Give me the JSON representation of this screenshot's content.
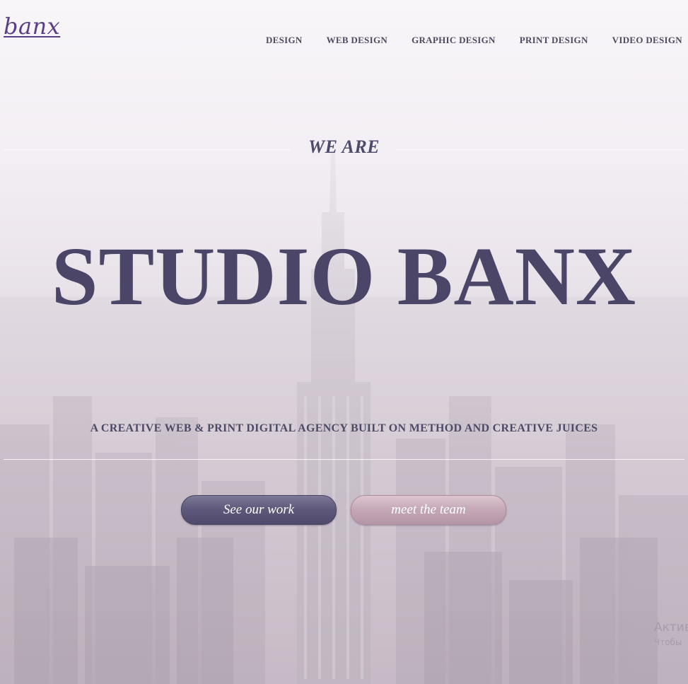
{
  "header": {
    "logo": "banx",
    "nav": [
      {
        "label": "DESIGN"
      },
      {
        "label": "WEB DESIGN"
      },
      {
        "label": "GRAPHIC DESIGN"
      },
      {
        "label": "PRINT DESIGN"
      },
      {
        "label": "VIDEO DESIGN"
      }
    ]
  },
  "hero": {
    "kicker": "WE ARE",
    "title": "STUDIO BANX",
    "tagline": "A CREATIVE WEB & PRINT DIGITAL AGENCY BUILT ON METHOD AND CREATIVE JUICES",
    "buttons": {
      "primary": "See our work",
      "secondary": "meet the team"
    }
  },
  "overlay": {
    "line1": "Актив",
    "line2": "Чтобы"
  },
  "colors": {
    "heading": "#4b4568",
    "logo": "#5a3f86",
    "button_primary": "#5f5a7c",
    "button_secondary": "#c6a9b8"
  },
  "background": {
    "icon": "city-skyline-photo"
  }
}
